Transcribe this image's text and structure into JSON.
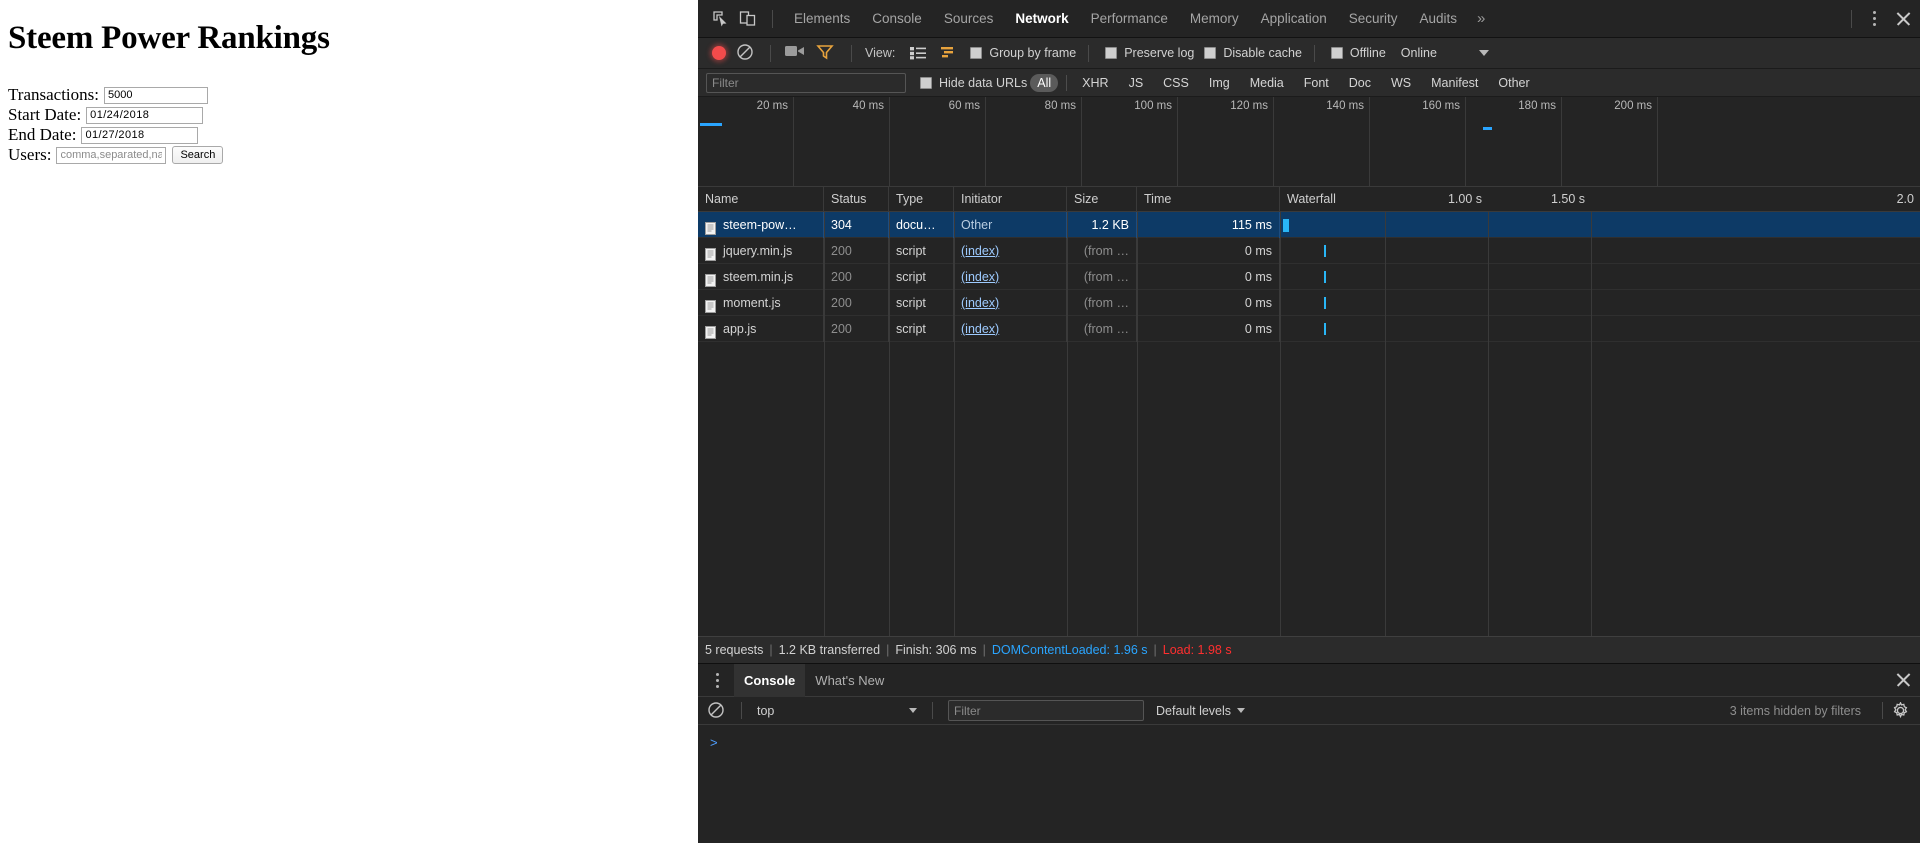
{
  "page": {
    "title": "Steem Power Rankings",
    "form": {
      "transactions": {
        "label": "Transactions:",
        "value": "5000",
        "placeholder": ""
      },
      "start_date": {
        "label": "Start Date:",
        "value": "01/24/2018",
        "placeholder": ""
      },
      "end_date": {
        "label": "End Date:",
        "value": "01/27/2018",
        "placeholder": ""
      },
      "users": {
        "label": "Users:",
        "value": "",
        "placeholder": "comma,separated,name"
      },
      "search_button": "Search"
    }
  },
  "devtools": {
    "tabs": [
      {
        "label": "Elements",
        "active": false
      },
      {
        "label": "Console",
        "active": false
      },
      {
        "label": "Sources",
        "active": false
      },
      {
        "label": "Network",
        "active": true
      },
      {
        "label": "Performance",
        "active": false
      },
      {
        "label": "Memory",
        "active": false
      },
      {
        "label": "Application",
        "active": false
      },
      {
        "label": "Security",
        "active": false
      },
      {
        "label": "Audits",
        "active": false
      }
    ],
    "more_tabs_glyph": "»",
    "icons": {
      "inspect": "inspect-element-icon",
      "device": "device-toolbar-icon",
      "record": "record-icon",
      "clear": "clear-icon",
      "camera": "capture-screenshots-icon",
      "funnel": "filter-icon",
      "kebab": "more-options-icon",
      "close": "close-icon",
      "gear": "settings-icon"
    },
    "network_toolbar": {
      "view_label": "View:",
      "group_by_frame": "Group by frame",
      "preserve_log": "Preserve log",
      "disable_cache": "Disable cache",
      "offline": "Offline",
      "throttling": "Online"
    },
    "filter_bar": {
      "filter_placeholder": "Filter",
      "filter_value": "",
      "hide_data_urls": "Hide data URLs",
      "types": [
        "All",
        "XHR",
        "JS",
        "CSS",
        "Img",
        "Media",
        "Font",
        "Doc",
        "WS",
        "Manifest",
        "Other"
      ],
      "selected_type": "All"
    },
    "overview": {
      "ticks": [
        "20 ms",
        "40 ms",
        "60 ms",
        "80 ms",
        "100 ms",
        "120 ms",
        "140 ms",
        "160 ms",
        "180 ms",
        "200 ms"
      ]
    },
    "table": {
      "columns": [
        "Name",
        "Status",
        "Type",
        "Initiator",
        "Size",
        "Time",
        "Waterfall"
      ],
      "waterfall_ticks": [
        "1.00 s",
        "1.50 s",
        "2.0"
      ],
      "rows": [
        {
          "name": "steem-pow…",
          "status": "304",
          "type": "docu…",
          "initiator": "Other",
          "size": "1.2 KB",
          "time": "115 ms",
          "selected": true
        },
        {
          "name": "jquery.min.js",
          "status": "200",
          "type": "script",
          "initiator": "(index)",
          "size": "(from …",
          "time": "0 ms",
          "selected": false
        },
        {
          "name": "steem.min.js",
          "status": "200",
          "type": "script",
          "initiator": "(index)",
          "size": "(from …",
          "time": "0 ms",
          "selected": false
        },
        {
          "name": "moment.js",
          "status": "200",
          "type": "script",
          "initiator": "(index)",
          "size": "(from …",
          "time": "0 ms",
          "selected": false
        },
        {
          "name": "app.js",
          "status": "200",
          "type": "script",
          "initiator": "(index)",
          "size": "(from …",
          "time": "0 ms",
          "selected": false
        }
      ]
    },
    "summary": {
      "requests": "5 requests",
      "transferred": "1.2 KB transferred",
      "finish": "Finish: 306 ms",
      "dom_content_loaded": "DOMContentLoaded: 1.96 s",
      "load": "Load: 1.98 s",
      "separator": "|",
      "dcl_color": "#2aa5ff",
      "load_color": "#ff2f2f"
    },
    "drawer": {
      "tabs": [
        {
          "label": "Console",
          "active": true
        },
        {
          "label": "What's New",
          "active": false
        }
      ],
      "context": "top",
      "filter_placeholder": "Filter",
      "filter_value": "",
      "levels": "Default levels",
      "hidden_message": "3 items hidden by filters",
      "prompt": ">"
    }
  }
}
